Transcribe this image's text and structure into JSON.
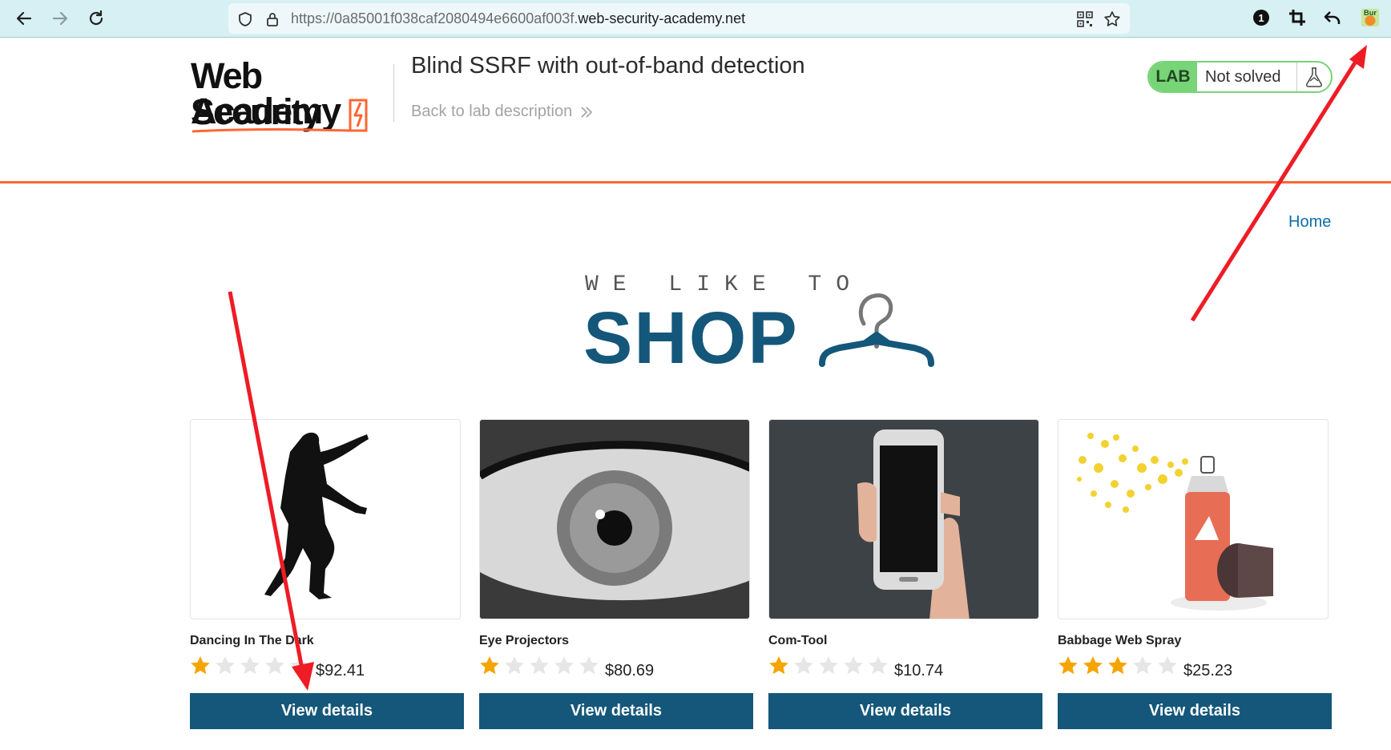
{
  "browser": {
    "url_prefix": "https://0a85001f038caf2080494e6600af003f.",
    "url_domain": "web-security-academy.net",
    "extensions": [
      "notification-badge-icon",
      "crop-icon",
      "undo-icon",
      "burp-icon"
    ],
    "badge_count": "1",
    "burp_label": "Bur"
  },
  "header": {
    "logo_line1": "Web Security",
    "logo_line2": "Academy",
    "lab_title": "Blind SSRF with out-of-band detection",
    "back_link": "Back to lab description",
    "lab_badge": "LAB",
    "lab_status": "Not solved"
  },
  "nav": {
    "home": "Home"
  },
  "hero": {
    "small": "WE LIKE TO",
    "big": "SHOP"
  },
  "products": [
    {
      "name": "Dancing In The Dark",
      "rating": 1,
      "price": "$92.41",
      "button": "View details",
      "image": "dancing-silhouette"
    },
    {
      "name": "Eye Projectors",
      "rating": 1,
      "price": "$80.69",
      "button": "View details",
      "image": "eye-closeup"
    },
    {
      "name": "Com-Tool",
      "rating": 1,
      "price": "$10.74",
      "button": "View details",
      "image": "hand-phone"
    },
    {
      "name": "Babbage Web Spray",
      "rating": 3,
      "price": "$25.23",
      "button": "View details",
      "image": "spray-can"
    }
  ],
  "colors": {
    "accent_orange": "#ff6633",
    "brand_blue": "#14577a",
    "lab_green": "#77d477",
    "star_gold": "#f5a500",
    "annotation_red": "#ee1c25"
  }
}
